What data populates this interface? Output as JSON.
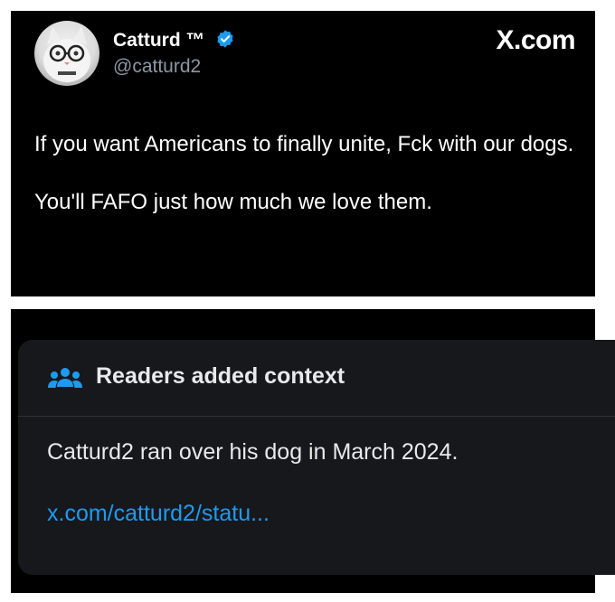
{
  "tweet": {
    "display_name": "Catturd ™",
    "handle": "@catturd2",
    "brand": "X.com",
    "paragraphs": [
      "If you want Americans to finally unite, Fck with our dogs.",
      "You'll FAFO just how much we love them."
    ]
  },
  "community_note": {
    "title": "Readers added context",
    "body": "Catturd2 ran over his dog in March 2024.",
    "link": "x.com/catturd2/statu..."
  },
  "colors": {
    "background": "#000000",
    "verified_badge": "#1d9bf0",
    "link": "#1d9bf0",
    "handle": "#8b98a5",
    "note_card": "#16181c"
  },
  "icons": {
    "verified": "verified-badge-icon",
    "note_header": "people-icon"
  }
}
